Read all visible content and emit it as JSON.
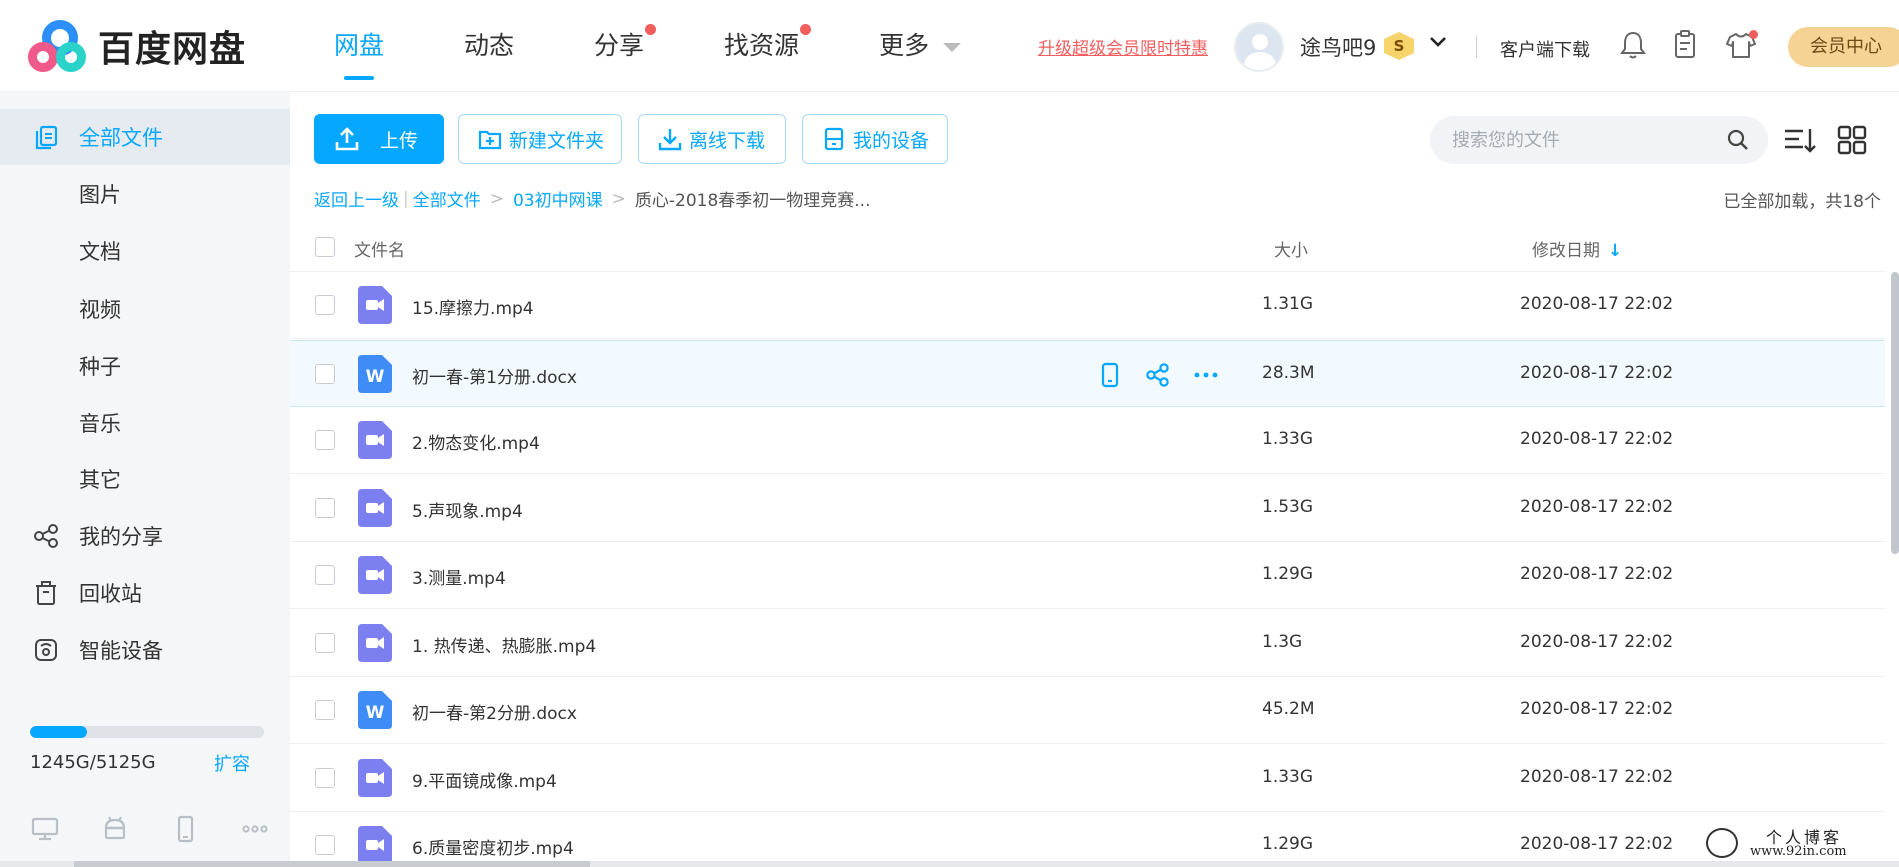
{
  "brand": {
    "name": "百度网盘"
  },
  "nav": [
    {
      "label": "网盘",
      "active": true,
      "dot": false
    },
    {
      "label": "动态",
      "active": false,
      "dot": false
    },
    {
      "label": "分享",
      "active": false,
      "dot": true
    },
    {
      "label": "找资源",
      "active": false,
      "dot": true
    },
    {
      "label": "更多",
      "active": false,
      "dot": false
    }
  ],
  "header": {
    "promo": "升级超级会员限时特惠",
    "username": "途鸟吧9",
    "vip_badge": "S",
    "client_download": "客户端下载",
    "member_center": "会员中心"
  },
  "sidebar": {
    "items": [
      {
        "label": "全部文件",
        "icon": "all-files-icon"
      },
      {
        "label": "图片"
      },
      {
        "label": "文档"
      },
      {
        "label": "视频"
      },
      {
        "label": "种子"
      },
      {
        "label": "音乐"
      },
      {
        "label": "其它"
      },
      {
        "label": "我的分享",
        "icon": "share-icon"
      },
      {
        "label": "回收站",
        "icon": "trash-icon"
      },
      {
        "label": "智能设备",
        "icon": "smart-device-icon"
      }
    ],
    "quota_text": "1245G/5125G",
    "quota_used_fraction": 0.243,
    "expand": "扩容"
  },
  "toolbar": {
    "upload": "上传",
    "new_folder": "新建文件夹",
    "offline_download": "离线下载",
    "my_devices": "我的设备",
    "search_placeholder": "搜索您的文件"
  },
  "breadcrumb": {
    "back": "返回上一级",
    "items": [
      "全部文件",
      "03初中网课",
      "质心-2018春季初一物理竞赛..."
    ],
    "loaded_text": "已全部加载，共18个"
  },
  "table": {
    "col_name": "文件名",
    "col_size": "大小",
    "col_date": "修改日期",
    "rows": [
      {
        "name": "15.摩擦力.mp4",
        "size": "1.31G",
        "date": "2020-08-17 22:02",
        "type": "video"
      },
      {
        "name": "初一春-第1分册.docx",
        "size": "28.3M",
        "date": "2020-08-17 22:02",
        "type": "word"
      },
      {
        "name": "2.物态变化.mp4",
        "size": "1.33G",
        "date": "2020-08-17 22:02",
        "type": "video"
      },
      {
        "name": "5.声现象.mp4",
        "size": "1.53G",
        "date": "2020-08-17 22:02",
        "type": "video"
      },
      {
        "name": "3.测量.mp4",
        "size": "1.29G",
        "date": "2020-08-17 22:02",
        "type": "video"
      },
      {
        "name": "1. 热传递、热膨胀.mp4",
        "size": "1.3G",
        "date": "2020-08-17 22:02",
        "type": "video"
      },
      {
        "name": "初一春-第2分册.docx",
        "size": "45.2M",
        "date": "2020-08-17 22:02",
        "type": "word"
      },
      {
        "name": "9.平面镜成像.mp4",
        "size": "1.33G",
        "date": "2020-08-17 22:02",
        "type": "video"
      },
      {
        "name": "6.质量密度初步.mp4",
        "size": "1.29G",
        "date": "2020-08-17 22:02",
        "type": "video"
      }
    ]
  },
  "watermark": {
    "title": "个人博客",
    "url": "www.92in.com"
  },
  "colors": {
    "accent": "#06a7ff",
    "video_icon": "#7b7ff0",
    "word_icon": "#3f8cf7",
    "alert_dot": "#f25d5d"
  }
}
